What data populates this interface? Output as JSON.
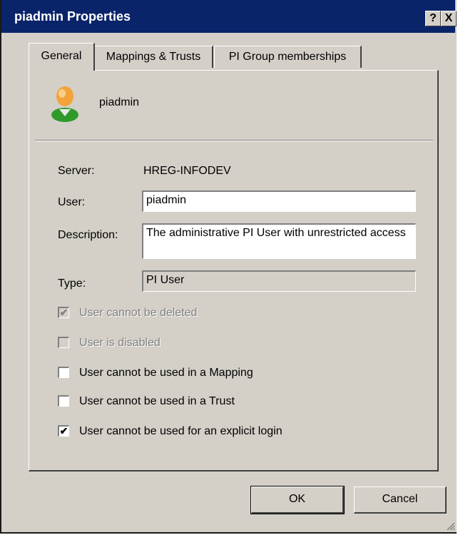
{
  "window": {
    "title": "piadmin Properties",
    "help_button": "?",
    "close_button": "X"
  },
  "tabs": [
    {
      "label": "General",
      "active": true
    },
    {
      "label": "Mappings & Trusts",
      "active": false
    },
    {
      "label": "PI Group memberships",
      "active": false
    }
  ],
  "header": {
    "icon": "user-icon",
    "name": "piadmin"
  },
  "fields": {
    "server_label": "Server:",
    "server_value": "HREG-INFODEV",
    "user_label": "User:",
    "user_value": "piadmin",
    "description_label": "Description:",
    "description_value": "The administrative PI User with unrestricted access",
    "type_label": "Type:",
    "type_value": "PI User"
  },
  "checkboxes": [
    {
      "label": "User cannot be deleted",
      "checked": true,
      "enabled": false
    },
    {
      "label": "User is disabled",
      "checked": false,
      "enabled": false
    },
    {
      "label": "User cannot be used in a Mapping",
      "checked": false,
      "enabled": true
    },
    {
      "label": "User cannot be used in a Trust",
      "checked": false,
      "enabled": true
    },
    {
      "label": "User cannot be used for an explicit login",
      "checked": true,
      "enabled": true
    }
  ],
  "buttons": {
    "ok": "OK",
    "cancel": "Cancel"
  },
  "colors": {
    "titlebar": "#0a246a",
    "face": "#d4d0c8"
  }
}
